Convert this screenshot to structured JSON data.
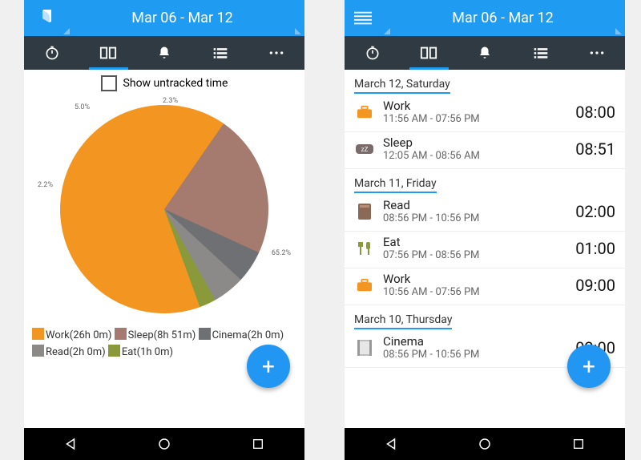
{
  "header": {
    "date_range": "Mar 06 - Mar 12"
  },
  "untracked_label": "Show untracked time",
  "colors": {
    "work": "#f39621",
    "sleep": "#a57a6f",
    "cinema": "#6f7073",
    "read": "#6f7073",
    "eat": "#8a9a3b",
    "accent": "#1f9bf1",
    "tabbg": "#2f3a42"
  },
  "chart_data": {
    "type": "pie",
    "title": "",
    "series": [
      {
        "name": "Work",
        "label": "Work(26h 0m)",
        "value": 26.0,
        "percent": 65.2,
        "color": "#f39621"
      },
      {
        "name": "Sleep",
        "label": "Sleep(8h 51m)",
        "value": 8.85,
        "percent": 22.2,
        "color": "#a57a6f"
      },
      {
        "name": "Cinema",
        "label": "Cinema(2h 0m)",
        "value": 2.0,
        "percent": 5.0,
        "color": "#6f7073"
      },
      {
        "name": "Read",
        "label": "Read(2h 0m)",
        "value": 2.0,
        "percent": 5.0,
        "color": "#8b8a88"
      },
      {
        "name": "Eat",
        "label": "Eat(1h 0m)",
        "value": 1.0,
        "percent": 2.5,
        "color": "#8a9a3b"
      }
    ],
    "slice_labels": {
      "work": "65.2%",
      "sleep": "2.2%",
      "cinema": "5.0%",
      "eat": "2.3%"
    }
  },
  "days": [
    {
      "header": "March 12, Saturday",
      "entries": [
        {
          "icon": "briefcase-icon",
          "title": "Work",
          "range": "11:56 AM - 07:56 PM",
          "duration": "08:00"
        },
        {
          "icon": "sleep-icon",
          "title": "Sleep",
          "range": "12:05 AM - 08:56 AM",
          "duration": "08:51"
        }
      ]
    },
    {
      "header": "March 11, Friday",
      "entries": [
        {
          "icon": "book-icon",
          "title": "Read",
          "range": "08:56 PM - 10:56 PM",
          "duration": "02:00"
        },
        {
          "icon": "eat-icon",
          "title": "Eat",
          "range": "07:56 PM - 08:56 PM",
          "duration": "01:00"
        },
        {
          "icon": "briefcase-icon",
          "title": "Work",
          "range": "10:56 AM - 07:56 PM",
          "duration": "09:00"
        }
      ]
    },
    {
      "header": "March 10, Thursday",
      "entries": [
        {
          "icon": "film-icon",
          "title": "Cinema",
          "range": "08:56 PM - 10:56 PM",
          "duration": "02:00"
        }
      ]
    }
  ]
}
